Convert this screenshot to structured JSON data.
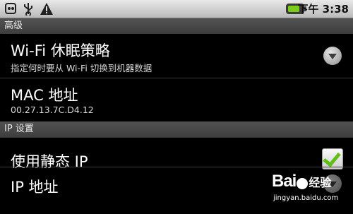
{
  "status_bar": {
    "left_icons": [
      "usb-debug-icon",
      "usb-icon",
      "warning-icon"
    ],
    "time": "下午 3:38"
  },
  "sections": {
    "advanced_header": "高级",
    "ip_header": "IP 设置"
  },
  "wifi_sleep": {
    "title": "Wi-Fi 休眠策略",
    "summary": "指定何时要从 Wi-Fi 切换到机器数据"
  },
  "mac": {
    "title": "MAC 地址",
    "value": "00.27.13.7C.D4.12"
  },
  "static_ip": {
    "title": "使用静态 IP",
    "checked": true
  },
  "ip_address": {
    "title": "IP 地址"
  },
  "watermark": {
    "logo": "Bai",
    "logo_suffix": "经验",
    "url": "jingyan.baidu.com"
  }
}
